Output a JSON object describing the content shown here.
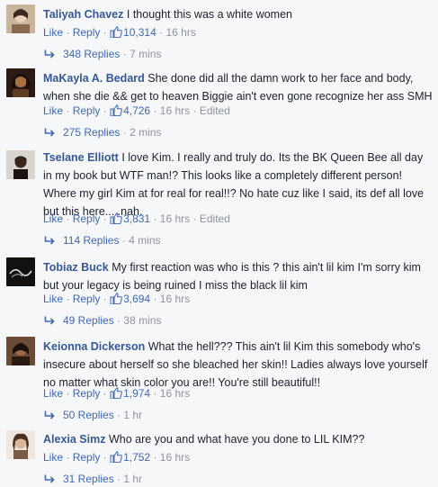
{
  "comments": [
    {
      "author": "Taliyah Chavez",
      "text": "I thought this was a white women",
      "like_label": "Like",
      "reply_label": "Reply",
      "likes": "10,314",
      "time": "16 hrs",
      "edited": "",
      "replies": "348 Replies",
      "replies_time": "7 mins"
    },
    {
      "author": "MaKayla A. Bedard",
      "text": "She done did all the damn work to her face and body, when she die && get to heaven Biggie ain't even gone recognize her ass SMH",
      "like_label": "Like",
      "reply_label": "Reply",
      "likes": "4,726",
      "time": "16 hrs",
      "edited": "Edited",
      "replies": "275 Replies",
      "replies_time": "2 mins"
    },
    {
      "author": "Tselane Elliott",
      "text": "I love Kim. I really and truly do. Its the BK Queen Bee all day in my book but WTF man!? This looks like a completely different person! Where my girl Kim at for real for real!!? No hate cuz like I said, its def all love but this here.....nah.",
      "like_label": "Like",
      "reply_label": "Reply",
      "likes": "3,831",
      "time": "16 hrs",
      "edited": "Edited",
      "replies": "114 Replies",
      "replies_time": "4 mins"
    },
    {
      "author": "Tobiaz Buck",
      "text": "My first reaction was who is this ? this ain't lil kim I'm sorry kim but your legacy is being ruined I miss the black lil kim",
      "like_label": "Like",
      "reply_label": "Reply",
      "likes": "3,694",
      "time": "16 hrs",
      "edited": "",
      "replies": "49 Replies",
      "replies_time": "38 mins"
    },
    {
      "author": "Keionna Dickerson",
      "text": "What the hell??? This ain't lil Kim this somebody who's insecure about herself so she bleached her skin!! Ladies always love yourself no matter what skin color you are!! You're still beautiful!!",
      "like_label": "Like",
      "reply_label": "Reply",
      "likes": "1,974",
      "time": "16 hrs",
      "edited": "",
      "replies": "50 Replies",
      "replies_time": "1 hr"
    },
    {
      "author": "Alexia Simz",
      "text": "Who are you and what have you done to LIL KIM??",
      "like_label": "Like",
      "reply_label": "Reply",
      "likes": "1,752",
      "time": "16 hrs",
      "edited": "",
      "replies": "31 Replies",
      "replies_time": "1 hr"
    }
  ],
  "colors": {
    "author": "#365899",
    "link": "#4267b2",
    "meta": "#90949c",
    "background": "#f6f7f9"
  },
  "icons": {
    "like": "thumbs-up-icon",
    "reply_arrow": "reply-arrow-icon"
  }
}
